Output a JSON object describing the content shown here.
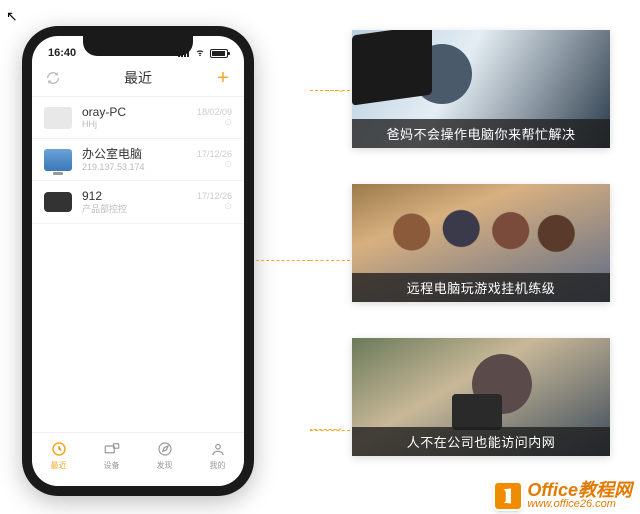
{
  "status_bar": {
    "time": "16:40"
  },
  "nav": {
    "title": "最近",
    "left_icon": "refresh-icon",
    "right_icon": "add-icon"
  },
  "device_list": [
    {
      "name": "oray-PC",
      "sub": "HHj",
      "date": "18/02/09"
    },
    {
      "name": "办公室电脑",
      "sub": "219.137.53.174",
      "date": "17/12/26"
    },
    {
      "name": "912",
      "sub": "产品部控控",
      "date": "17/12/26"
    }
  ],
  "tabs": [
    {
      "label": "最近",
      "icon": "clock-icon",
      "active": true
    },
    {
      "label": "设备",
      "icon": "devices-icon",
      "active": false
    },
    {
      "label": "发现",
      "icon": "discover-icon",
      "active": false
    },
    {
      "label": "我的",
      "icon": "person-icon",
      "active": false
    }
  ],
  "cards": [
    {
      "caption": "爸妈不会操作电脑你来帮忙解决"
    },
    {
      "caption": "远程电脑玩游戏挂机练级"
    },
    {
      "caption": "人不在公司也能访问内网"
    }
  ],
  "watermark": {
    "title": "Office教程网",
    "url": "www.office26.com"
  },
  "colors": {
    "accent": "#f5a623"
  }
}
